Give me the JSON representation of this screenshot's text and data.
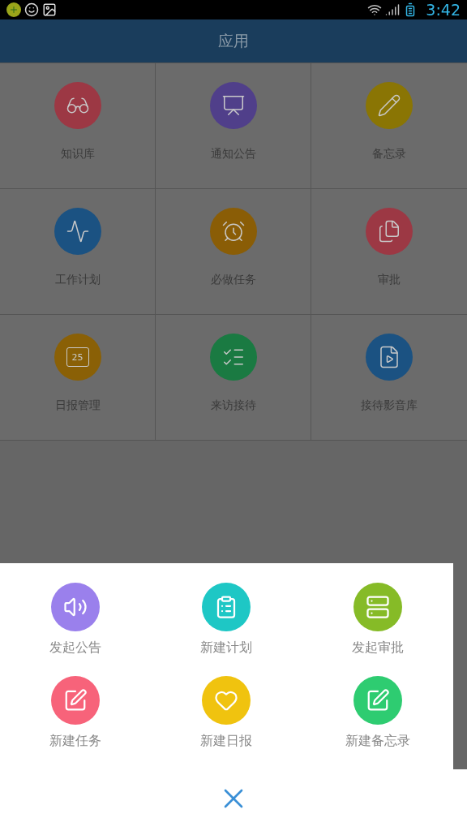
{
  "status_bar": {
    "time": "3:42"
  },
  "header": {
    "title": "应用"
  },
  "apps": [
    {
      "label": "知识库",
      "color": "#9c3844"
    },
    {
      "label": "通知公告",
      "color": "#503f8a"
    },
    {
      "label": "备忘录",
      "color": "#8a7504"
    },
    {
      "label": "工作计划",
      "color": "#1b5282"
    },
    {
      "label": "必做任务",
      "color": "#8a5d06"
    },
    {
      "label": "审批",
      "color": "#9c3844"
    },
    {
      "label": "日报管理",
      "color": "#8a6006",
      "icon_text": "25"
    },
    {
      "label": "来访接待",
      "color": "#1a7a42"
    },
    {
      "label": "接待影音库",
      "color": "#1b5282"
    }
  ],
  "quick_actions": [
    {
      "label": "发起公告",
      "color": "#9a80ec"
    },
    {
      "label": "新建计划",
      "color": "#1ec7c5"
    },
    {
      "label": "发起审批",
      "color": "#86bb27"
    },
    {
      "label": "新建任务",
      "color": "#f7637a"
    },
    {
      "label": "新建日报",
      "color": "#f0c30f"
    },
    {
      "label": "新建备忘录",
      "color": "#2ecc71"
    }
  ]
}
